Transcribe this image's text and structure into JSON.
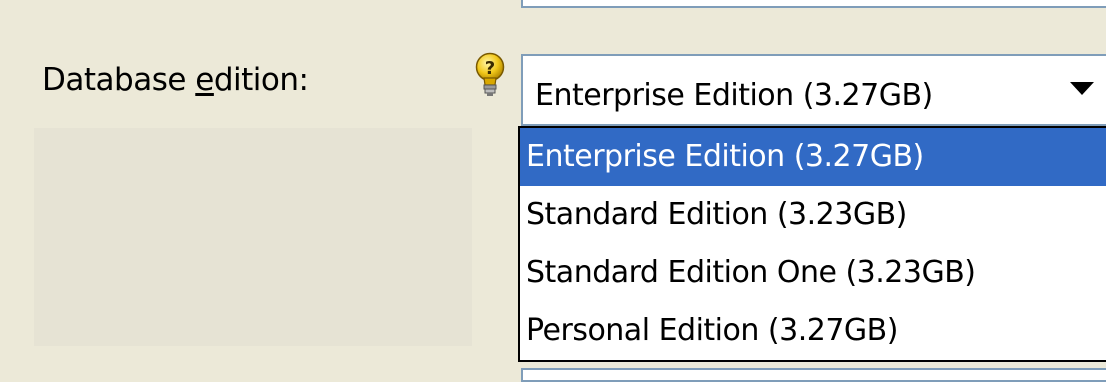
{
  "form": {
    "label_prefix": "Database ",
    "label_mnemonic": "e",
    "label_suffix": "dition:",
    "hint_icon": "question-bulb-icon"
  },
  "combo": {
    "selected": "Enterprise Edition (3.27GB)",
    "arrow_icon": "dropdown-arrow-icon"
  },
  "options": [
    {
      "label": "Enterprise Edition (3.27GB)",
      "selected": true
    },
    {
      "label": "Standard Edition (3.23GB)",
      "selected": false
    },
    {
      "label": "Standard Edition One (3.23GB)",
      "selected": false
    },
    {
      "label": "Personal Edition (3.27GB)",
      "selected": false
    }
  ],
  "colors": {
    "window_bg": "#ece9d8",
    "field_border": "#7f9db9",
    "selection": "#316ac5"
  }
}
